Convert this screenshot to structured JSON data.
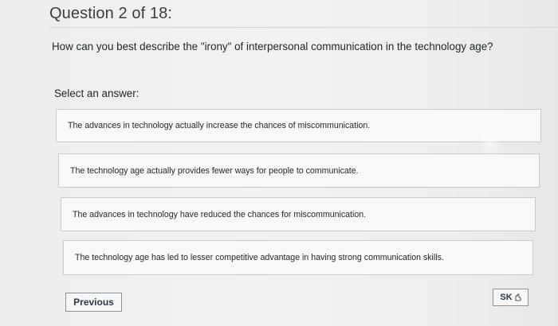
{
  "header": {
    "title": "Question 2 of 18:"
  },
  "question": {
    "text": "How can you best describe the \"irony\" of interpersonal communication in the technology age?"
  },
  "answers": {
    "label": "Select an answer:",
    "options": [
      {
        "text": "The advances in technology actually increase the chances of miscommunication."
      },
      {
        "text": "The technology age actually provides fewer ways for people to communicate."
      },
      {
        "text": "The advances in technology have reduced the chances for miscommunication."
      },
      {
        "text": "The technology age has led to lesser competitive advantage in having strong communication skills."
      }
    ]
  },
  "footer": {
    "previous_label": "Previous",
    "skip_label": "SK",
    "skip_icon": "pointer-cursor-icon"
  },
  "colors": {
    "background": "#eeefed",
    "option_background": "#f7f8f7",
    "option_border": "#c7cac7",
    "button_text": "#2b3a48"
  }
}
